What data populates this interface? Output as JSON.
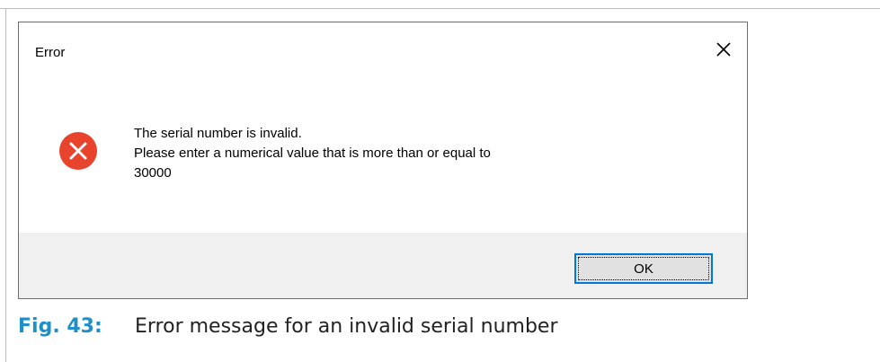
{
  "dialog": {
    "title": "Error",
    "close_icon": "close-icon",
    "error_icon": "error-circle-x-icon",
    "message_lines": [
      "The serial number is invalid.",
      "Please enter a numerical value that is more than or equal to",
      "30000"
    ],
    "ok_label": "OK"
  },
  "caption": {
    "figure_label": "Fig. 43:",
    "text": "Error message for an invalid serial number"
  },
  "colors": {
    "error_red": "#e8432d",
    "focus_blue": "#0078d7",
    "caption_blue": "#1f8fc8",
    "footer_gray": "#f0f0f0"
  }
}
